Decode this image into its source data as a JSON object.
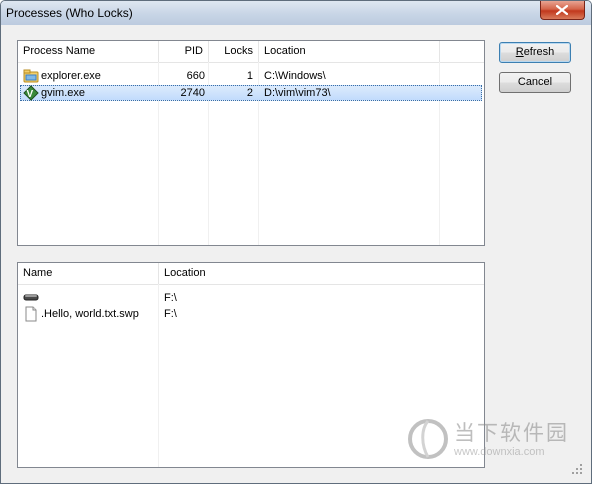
{
  "window": {
    "title": "Processes (Who Locks)"
  },
  "buttons": {
    "refresh": {
      "prefix": "",
      "mnemonic": "R",
      "rest": "efresh"
    },
    "cancel": "Cancel"
  },
  "processes": {
    "columns": [
      "Process Name",
      "PID",
      "Locks",
      "Location"
    ],
    "rows": [
      {
        "name": "explorer.exe",
        "pid": "660",
        "locks": "1",
        "location": "C:\\Windows\\",
        "icon": "explorer-icon",
        "selected": false
      },
      {
        "name": "gvim.exe",
        "pid": "2740",
        "locks": "2",
        "location": "D:\\vim\\vim73\\",
        "icon": "gvim-icon",
        "selected": true
      }
    ]
  },
  "files": {
    "columns": [
      "Name",
      "Location"
    ],
    "rows": [
      {
        "name": "",
        "location": "F:\\",
        "icon": "drive-icon"
      },
      {
        "name": ".Hello, world.txt.swp",
        "location": "F:\\",
        "icon": "file-icon"
      }
    ]
  },
  "watermark": {
    "text": "当下软件园",
    "url": "www.downxia.com",
    "logo": "downxia-logo-icon"
  },
  "colors": {
    "selection": "#c1dbfc",
    "selection_border": "#3a6ea5",
    "title_bar": "#c8d5e6",
    "close_button": "#c1381d"
  }
}
